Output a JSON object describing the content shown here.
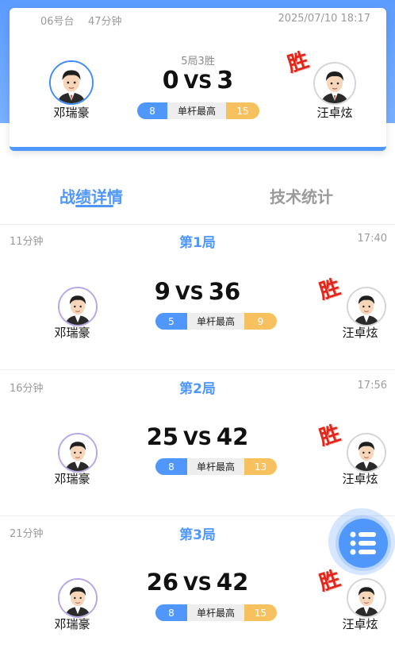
{
  "summary": {
    "table": "06号台",
    "duration": "47分钟",
    "datetime": "2025/07/10 18:17",
    "format": "5局3胜",
    "left_score": "0",
    "vs": "VS",
    "right_score": "3",
    "left_player": "邓瑞豪",
    "right_player": "汪卓炫",
    "left_break": "8",
    "break_label": "单杆最高",
    "right_break": "15",
    "win_label": "胜"
  },
  "tabs": {
    "active": "战绩详情",
    "inactive": "技术统计"
  },
  "frames": [
    {
      "duration": "11分钟",
      "title": "第1局",
      "time": "17:40",
      "left_score": "9",
      "vs": "VS",
      "right_score": "36",
      "left_break": "5",
      "break_label": "单杆最高",
      "right_break": "9",
      "left_player": "邓瑞豪",
      "right_player": "汪卓炫",
      "win_label": "胜"
    },
    {
      "duration": "16分钟",
      "title": "第2局",
      "time": "17:56",
      "left_score": "25",
      "vs": "VS",
      "right_score": "42",
      "left_break": "8",
      "break_label": "单杆最高",
      "right_break": "13",
      "left_player": "邓瑞豪",
      "right_player": "汪卓炫",
      "win_label": "胜"
    },
    {
      "duration": "21分钟",
      "title": "第3局",
      "time": "",
      "left_score": "26",
      "vs": "VS",
      "right_score": "42",
      "left_break": "8",
      "break_label": "单杆最高",
      "right_break": "15",
      "left_player": "邓瑞豪",
      "right_player": "汪卓炫",
      "win_label": "胜"
    }
  ],
  "fab": {
    "icon": "list-menu-icon"
  },
  "colors": {
    "accent": "#4f97fb",
    "gold": "#f7c15f",
    "win": "#e0261b"
  }
}
